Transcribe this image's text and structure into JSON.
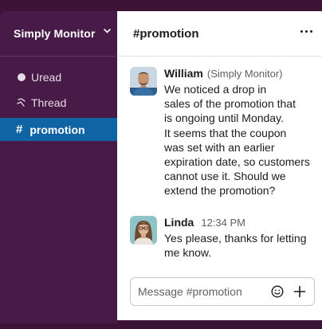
{
  "workspace": {
    "name": "Simply Monitor"
  },
  "sidebar": {
    "items": [
      {
        "label": "Uread",
        "icon": "circle-icon"
      },
      {
        "label": "Thread",
        "icon": "thread-icon"
      },
      {
        "label": "promotion",
        "icon": "hash-icon",
        "prefix": "#"
      }
    ]
  },
  "channel": {
    "title": "#promotion"
  },
  "messages": [
    {
      "author": "William",
      "meta": "(Simply Monitor)",
      "lines": [
        "We noticed a drop in",
        "sales of the promotion that",
        "is ongoing until Monday.",
        "It seems that the coupon",
        "was set with an earlier",
        "expiration date, so customers",
        "cannot use it. Should we",
        "extend the promotion?"
      ]
    },
    {
      "author": "Linda",
      "meta": "12:34 PM",
      "lines": [
        "Yes please, thanks for letting",
        "me know."
      ]
    }
  ],
  "composer": {
    "placeholder": "Message #promotion"
  },
  "colors": {
    "sidebar_bg": "#481a47",
    "active_item": "#1164a3",
    "outer_bg": "#3b1438"
  }
}
